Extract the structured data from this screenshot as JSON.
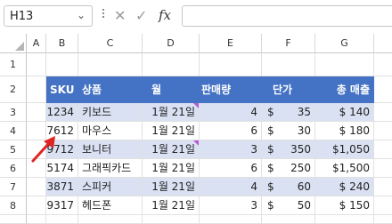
{
  "toolbar": {
    "name_box": "H13",
    "fx_label": "fx",
    "formula_value": ""
  },
  "columns": [
    "A",
    "B",
    "C",
    "D",
    "E",
    "F",
    "G"
  ],
  "rows": [
    "1",
    "2",
    "3",
    "4",
    "5",
    "6",
    "7",
    "8"
  ],
  "table": {
    "headers": [
      "SKU",
      "상품",
      "월",
      "판매량",
      "단가",
      "총 매출"
    ],
    "records": [
      {
        "sku": "1234",
        "product": "키보드",
        "month": "1월 21일",
        "qty": "4",
        "price": "35",
        "total": "$ 140",
        "has_flag": true
      },
      {
        "sku": "7612",
        "product": "마우스",
        "month": "1월 21일",
        "qty": "6",
        "price": "30",
        "total": "$ 180",
        "has_flag": false
      },
      {
        "sku": "9712",
        "product": "보니터",
        "month": "1월 21일",
        "qty": "3",
        "price": "350",
        "total": "$1,050",
        "has_flag": true
      },
      {
        "sku": "5174",
        "product": "그래픽카드",
        "month": "1월 21일",
        "qty": "6",
        "price": "250",
        "total": "$1,500",
        "has_flag": false
      },
      {
        "sku": "3871",
        "product": "스피커",
        "month": "1월 21일",
        "qty": "4",
        "price": "60",
        "total": "$ 240",
        "has_flag": false
      },
      {
        "sku": "9317",
        "product": "헤드폰",
        "month": "1월 21일",
        "qty": "3",
        "price": "50",
        "total": "$ 150",
        "has_flag": false
      }
    ]
  },
  "currency_symbol": "$",
  "colors": {
    "header_fill": "#4472c4",
    "band_fill": "#d9e1f2",
    "flag": "#b659d9",
    "arrow": "#e02424"
  }
}
